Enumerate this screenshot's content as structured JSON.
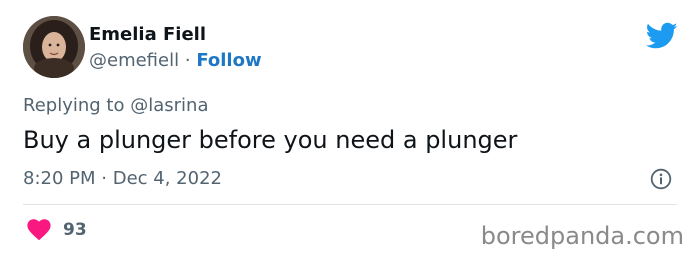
{
  "author": {
    "display_name": "Emelia Fiell",
    "handle": "@emefiell",
    "separator": "·",
    "follow_label": "Follow"
  },
  "brand": {
    "icon": "twitter-bird-icon",
    "color": "#1d9bf0"
  },
  "tweet": {
    "reply_prefix": "Replying to",
    "reply_to": "@lasrina",
    "text": "Buy a plunger before you need a plunger",
    "time": "8:20 PM",
    "date_separator": "·",
    "date": "Dec 4, 2022"
  },
  "engagement": {
    "like_icon": "heart-icon",
    "like_color": "#f91880",
    "likes": "93",
    "info_icon": "info-icon"
  },
  "watermark": {
    "text": "boredpanda.com"
  }
}
